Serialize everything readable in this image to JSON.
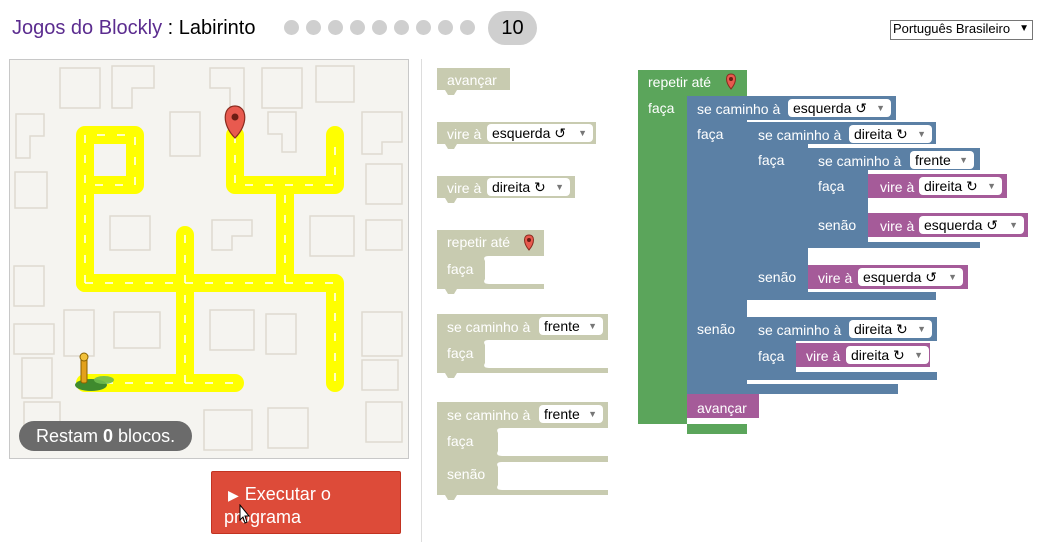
{
  "header": {
    "app_name": "Jogos do Blockly",
    "separator": " : ",
    "game_name": "Labirinto",
    "level_current": "10",
    "levels_done_count": 9
  },
  "language": {
    "selected": "Português Brasileiro"
  },
  "maze": {
    "remaining_prefix": "Restam ",
    "remaining_count": "0",
    "remaining_suffix": " blocos."
  },
  "run_button": {
    "label": "Executar o programa"
  },
  "toolbox": {
    "move_forward": "avançar",
    "turn_left": {
      "label": "vire à",
      "value": "esquerda ↺"
    },
    "turn_right": {
      "label": "vire à",
      "value": "direita ↻"
    },
    "repeat": {
      "label": "repetir até",
      "do": "faça"
    },
    "if_path": {
      "label": "se caminho à",
      "value": "frente",
      "do": "faça"
    },
    "if_else_path": {
      "label": "se caminho à",
      "value": "frente",
      "do": "faça",
      "else": "senão"
    }
  },
  "workspace": {
    "repeat_label": "repetir até",
    "do": "faça",
    "else": "senão",
    "if_label": "se caminho à",
    "turn_label": "vire à",
    "left": "esquerda ↺",
    "right": "direita ↻",
    "ahead": "frente",
    "move_forward": "avançar"
  },
  "colors": {
    "loop": "#5ba55b",
    "logic": "#5b80a5",
    "action": "#a55b99",
    "run": "#dd4b39",
    "path": "#ffff00"
  }
}
